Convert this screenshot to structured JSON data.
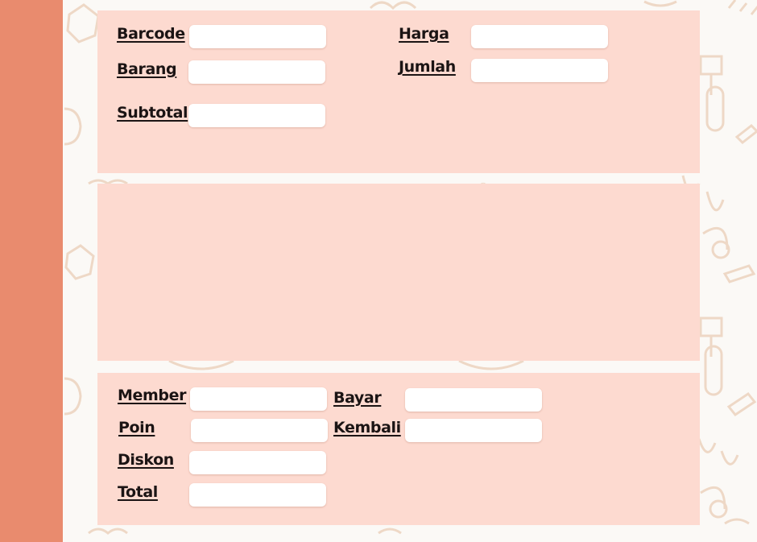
{
  "colors": {
    "sidebar": "#e98b6e",
    "panel": "#fddad0",
    "background": "#fbf9f6",
    "pattern": "#eed8c6"
  },
  "item_panel": {
    "barcode": {
      "label": "Barcode",
      "value": ""
    },
    "barang": {
      "label": "Barang",
      "value": ""
    },
    "subtotal": {
      "label": "Subtotal",
      "value": ""
    },
    "harga": {
      "label": "Harga",
      "value": ""
    },
    "jumlah": {
      "label": "Jumlah",
      "value": ""
    }
  },
  "transaction_panel": {
    "member": {
      "label": "Member",
      "value": ""
    },
    "poin": {
      "label": "Poin",
      "value": ""
    },
    "diskon": {
      "label": "Diskon",
      "value": ""
    },
    "total": {
      "label": "Total",
      "value": ""
    },
    "bayar": {
      "label": "Bayar",
      "value": ""
    },
    "kembali": {
      "label": "Kembali",
      "value": ""
    }
  }
}
